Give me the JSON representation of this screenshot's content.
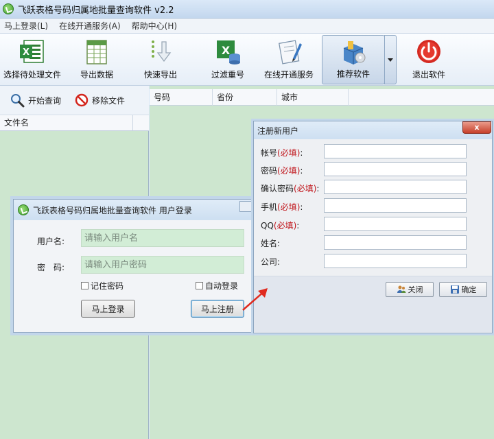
{
  "window": {
    "title": "飞跃表格号码归属地批量查询软件 v2.2"
  },
  "menu": [
    "马上登录(L)",
    "在线开通服务(A)",
    "帮助中心(H)"
  ],
  "toolbar": {
    "select_file": "选择待处理文件",
    "export": "导出数据",
    "quick_export": "快速导出",
    "filter_dup": "过滤重号",
    "online_service": "在线开通服务",
    "recommend": "推荐软件",
    "exit": "退出软件"
  },
  "left": {
    "start_query": "开始查询",
    "remove_file": "移除文件",
    "file_col": "文件名"
  },
  "grid": {
    "columns": [
      "号码",
      "省份",
      "城市"
    ]
  },
  "login": {
    "title": "飞跃表格号码归属地批量查询软件 用户登录",
    "user_label": "用户名:",
    "user_placeholder": "请输入用户名",
    "pwd_label": "密　码:",
    "pwd_placeholder": "请输入用户密码",
    "remember": "记住密码",
    "auto_login": "自动登录",
    "login_btn": "马上登录",
    "register_btn": "马上注册"
  },
  "register": {
    "title": "注册新用户",
    "close_glyph": "x",
    "fields": [
      {
        "label": "帐号",
        "req": "(必填)",
        "colon": ":"
      },
      {
        "label": "密码",
        "req": "(必填)",
        "colon": ":"
      },
      {
        "label": "确认密码",
        "req": "(必填)",
        "colon": ":"
      },
      {
        "label": "手机",
        "req": "(必填)",
        "colon": ":"
      },
      {
        "label": "QQ",
        "req": "(必填)",
        "colon": ":"
      },
      {
        "label": "姓名",
        "req": "",
        "colon": ":"
      },
      {
        "label": "公司",
        "req": "",
        "colon": ":"
      }
    ],
    "close_btn": "关闭",
    "ok_btn": "确定"
  }
}
